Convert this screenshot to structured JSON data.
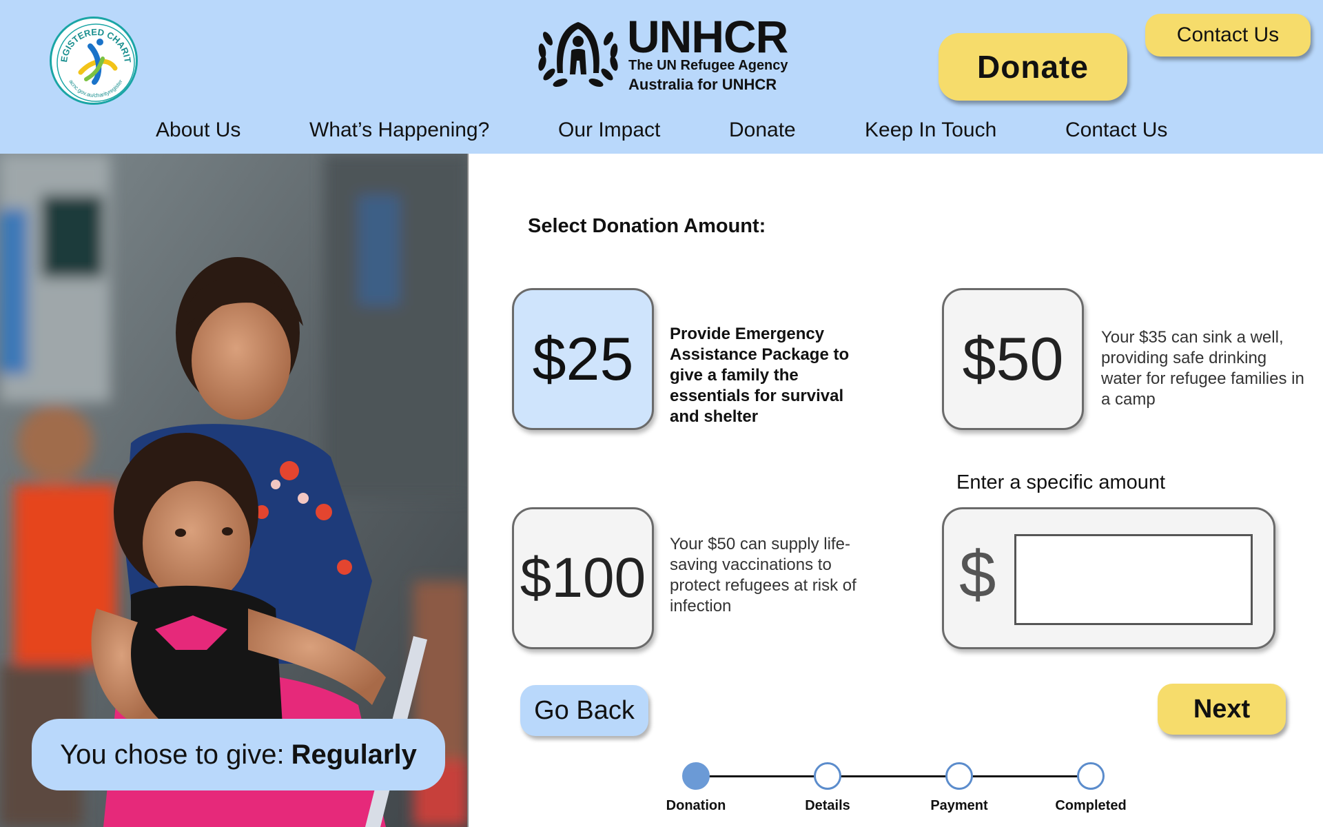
{
  "header": {
    "badge": {
      "top_text": "REGISTERED CHARITY",
      "bottom_text": "acnc.gov.au/charityregister"
    },
    "logo": {
      "wordmark": "UNHCR",
      "subtitle_1": "The UN Refugee Agency",
      "subtitle_2": "Australia for UNHCR"
    },
    "donate_label": "Donate",
    "contact_label": "Contact Us",
    "nav": [
      "About Us",
      "What’s Happening?",
      "Our Impact",
      "Donate",
      "Keep In Touch",
      "Contact Us"
    ]
  },
  "hero": {
    "chose_prefix": "You chose to give:",
    "chose_value": "Regularly"
  },
  "form": {
    "title": "Select Donation Amount:",
    "options": [
      {
        "amount": "$25",
        "description": "Provide Emergency Assistance Package to give a family the essentials for survival and shelter",
        "selected": true
      },
      {
        "amount": "$50",
        "description": "Your $35 can sink a well, providing safe drinking water for refugee families in a camp",
        "selected": false
      },
      {
        "amount": "$100",
        "description": "Your $50 can supply life-saving vaccinations to protect refugees at risk of infection",
        "selected": false
      }
    ],
    "custom_label": "Enter a specific amount",
    "currency_symbol": "$",
    "custom_value": "",
    "back_label": "Go Back",
    "next_label": "Next"
  },
  "progress": {
    "current_step": 1,
    "steps": [
      "Donation",
      "Details",
      "Payment",
      "Completed"
    ]
  },
  "colors": {
    "header_bg": "#b9d8fb",
    "button_yellow": "#f6dc6b",
    "selected_card": "#cfe4fc",
    "progress_active": "#6b9ad6"
  }
}
